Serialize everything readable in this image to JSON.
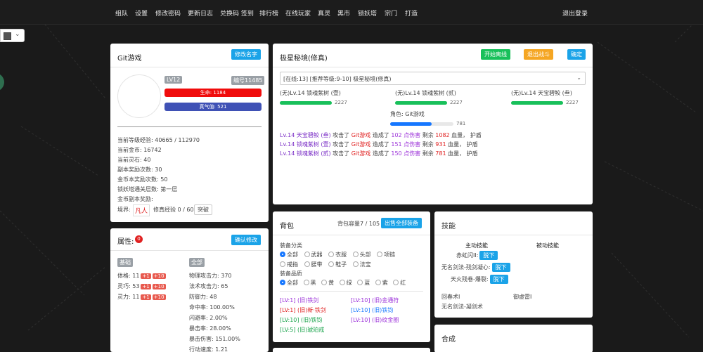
{
  "nav": {
    "items": [
      "组队",
      "设置",
      "修改密码",
      "更新日志",
      "兑换码 签到",
      "排行榜",
      "在线玩家",
      "真灵",
      "黑市",
      "锁妖塔",
      "宗门",
      "打造"
    ],
    "logout": "退出登录"
  },
  "profile": {
    "title": "Git游戏",
    "rename_btn": "修改名字",
    "level": "LV12",
    "id_label": "编号11485",
    "hp": "生命: 1184",
    "qi": "真气值: 521",
    "stats": [
      "当前等级经验: 40665 / 112970",
      "当前金币: 16742",
      "当前灵石: 40",
      "副本奖励次数: 30",
      "金币本奖励次数: 50",
      "锁妖塔通关层数: 第一层",
      "金币副本奖励:"
    ],
    "realm_label": "境界:",
    "realm_value": "凡人",
    "realm_exp": "修真经验 0 / 60",
    "breakthrough_btn": "突破"
  },
  "battle": {
    "title": "极星秘境(修真)",
    "start_btn": "开始离线",
    "exit_btn": "退出战斗",
    "ok_btn": "确定",
    "select_value": "[在线:13] [推荐等级:9-10] 极星秘境(修真)",
    "enemies": [
      {
        "name": "(无)Lv.14 锁魂紫树 (壹)",
        "hp": "2227",
        "fill": 1.0
      },
      {
        "name": "(无)Lv.14 锁魂紫树 (贰)",
        "hp": "2227",
        "fill": 1.0
      },
      {
        "name": "(无)Lv.14 天宝碧鲛 (叁)",
        "hp": "2227",
        "fill": 1.0
      }
    ],
    "player_label": "角色: Git游戏",
    "player_hp": "781",
    "player_fill": 0.66,
    "logs": [
      {
        "attacker": "Lv.14 天宝碧鲛 (叁)",
        "a": " 攻击了 ",
        "target": "Git游戏",
        "b": " 造成了 ",
        "dmg": "102 点伤害",
        "c": " 剩余 ",
        "rest": "1082",
        "d": " 血量， 护盾"
      },
      {
        "attacker": "Lv.14 锁魂紫树 (壹)",
        "a": " 攻击了 ",
        "target": "Git游戏",
        "b": " 造成了 ",
        "dmg": "151 点伤害",
        "c": " 剩余 ",
        "rest": "931",
        "d": " 血量， 护盾"
      },
      {
        "attacker": "Lv.14 锁魂紫树 (贰)",
        "a": " 攻击了 ",
        "target": "Git游戏",
        "b": " 造成了 ",
        "dmg": "150 点伤害",
        "c": " 剩余 ",
        "rest": "781",
        "d": " 血量， 护盾"
      }
    ]
  },
  "attributes": {
    "title": "属性:",
    "points": "0",
    "confirm_btn": "确认修改",
    "basic_tag": "基础",
    "all_tag": "全部",
    "basic": [
      {
        "label": "体格: 11",
        "plus1": "+1",
        "plus10": "+10"
      },
      {
        "label": "灵巧: 53",
        "plus1": "+1",
        "plus10": "+10"
      },
      {
        "label": "灵力: 11",
        "plus1": "+1",
        "plus10": "+10"
      }
    ],
    "all": [
      "物理攻击力: 370",
      "法术攻击力: 65",
      "防御力: 48",
      "命中率: 100.00%",
      "闪避率: 2.00%",
      "暴击率: 28.00%",
      "暴击伤害: 151.00%",
      "行动速度: 1.21"
    ]
  },
  "bag": {
    "title": "背包",
    "capacity": "背包容量7 / 105",
    "sell_btn": "出售全部装备",
    "category_label": "装备分类",
    "categories_row1": [
      "全部",
      "武器",
      "衣服",
      "头部",
      "项链"
    ],
    "categories_row2": [
      "戒指",
      "腰带",
      "鞋子",
      "法宝"
    ],
    "quality_label": "装备品质",
    "qualities": [
      "全部",
      "黑",
      "黄",
      "绿",
      "蓝",
      "紫",
      "红"
    ],
    "items": [
      {
        "text": "[LV:1] (旧)铁剑",
        "color": "#9b30d9"
      },
      {
        "text": "[LV:10] (旧)金通符",
        "color": "#9b30d9"
      },
      {
        "text": "[LV:1] (旧)新·铁剑",
        "color": "#e02020"
      },
      {
        "text": "[LV:10] (旧)铁钧",
        "color": "#1677ff"
      },
      {
        "text": "[LV:10] (旧)铁钧",
        "color": "#18a34a"
      },
      {
        "text": "[LV:10] (旧)纹金圈",
        "color": "#9b30d9"
      },
      {
        "text": "[LV:5] (旧)琥珀戒",
        "color": "#18a34a"
      }
    ]
  },
  "skills": {
    "title": "技能",
    "active_label": "主动技能",
    "passive_label": "被动技能",
    "active": [
      {
        "name": "赤虹闪II:",
        "btn": "脱下"
      },
      {
        "name": "无名剑法-残剑凝心:",
        "btn": "脱下"
      },
      {
        "name": "天火残卷-爆裂:",
        "btn": "脱下"
      }
    ],
    "learned": [
      "回春术I",
      "御虚雷I",
      "无名剑法-凝剑术"
    ]
  },
  "craft": {
    "title": "合成"
  }
}
